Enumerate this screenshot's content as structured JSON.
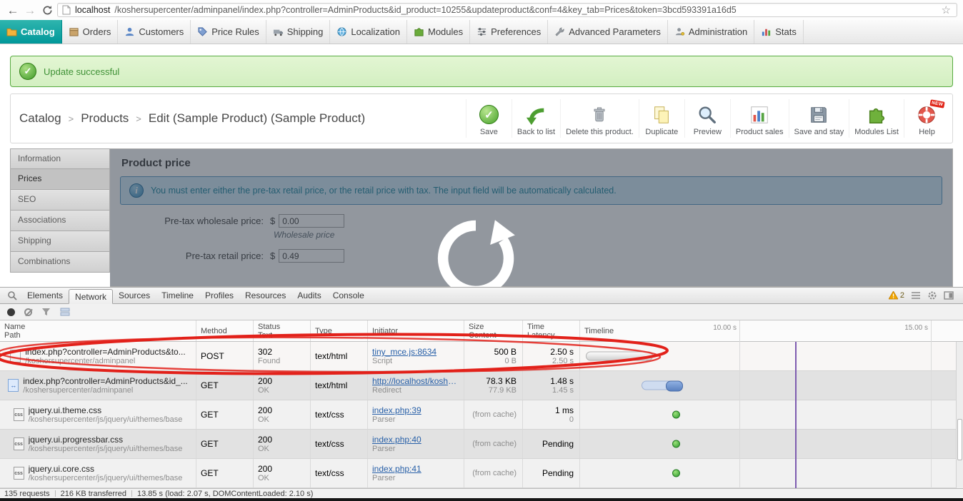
{
  "browser": {
    "url_host": "localhost",
    "url_path": "/koshersupercenter/adminpanel/index.php?controller=AdminProducts&id_product=10255&updateproduct&conf=4&key_tab=Prices&token=3bcd593391a16d5"
  },
  "admin_nav": {
    "tabs": [
      {
        "label": "Catalog"
      },
      {
        "label": "Orders"
      },
      {
        "label": "Customers"
      },
      {
        "label": "Price Rules"
      },
      {
        "label": "Shipping"
      },
      {
        "label": "Localization"
      },
      {
        "label": "Modules"
      },
      {
        "label": "Preferences"
      },
      {
        "label": "Advanced Parameters"
      },
      {
        "label": "Administration"
      },
      {
        "label": "Stats"
      }
    ]
  },
  "alert": {
    "message": "Update successful"
  },
  "breadcrumb": {
    "separator": ">",
    "parts": [
      "Catalog",
      "Products",
      "Edit (Sample Product) (Sample Product)"
    ]
  },
  "toolbar": {
    "buttons": [
      "Save",
      "Back to list",
      "Delete this product.",
      "Duplicate",
      "Preview",
      "Product sales",
      "Save and stay",
      "Modules List",
      "Help"
    ],
    "new_badge": "NEW"
  },
  "product_tabs": [
    {
      "label": "Information"
    },
    {
      "label": "Prices"
    },
    {
      "label": "SEO"
    },
    {
      "label": "Associations"
    },
    {
      "label": "Shipping"
    },
    {
      "label": "Combinations"
    }
  ],
  "panel": {
    "title": "Product price",
    "info": "You must enter either the pre-tax retail price, or the retail price with tax. The input field will be automatically calculated.",
    "fields": [
      {
        "label": "Pre-tax wholesale price:",
        "currency": "$",
        "value": "0.00",
        "hint": "Wholesale price"
      },
      {
        "label": "Pre-tax retail price:",
        "currency": "$",
        "value": "0.49"
      }
    ]
  },
  "devtools": {
    "tabs": [
      {
        "label": "Elements"
      },
      {
        "label": "Network"
      },
      {
        "label": "Sources"
      },
      {
        "label": "Timeline"
      },
      {
        "label": "Profiles"
      },
      {
        "label": "Resources"
      },
      {
        "label": "Audits"
      },
      {
        "label": "Console"
      }
    ],
    "active_tab": "Network",
    "warning_count": "2",
    "columns": [
      {
        "line1": "Name",
        "line2": "Path"
      },
      {
        "line1": "Method",
        "line2": ""
      },
      {
        "line1": "Status",
        "line2": "Text"
      },
      {
        "line1": "Type",
        "line2": ""
      },
      {
        "line1": "Initiator",
        "line2": ""
      },
      {
        "line1": "Size",
        "line2": "Content"
      },
      {
        "line1": "Time",
        "line2": "Latency"
      },
      {
        "line1": "Timeline",
        "line2": ""
      }
    ],
    "timeline_ticks": [
      "10.00 s",
      "15.00 s"
    ],
    "requests": [
      {
        "name": "index.php?controller=AdminProducts&to...",
        "path": "/koshersupercenter/adminpanel",
        "method": "POST",
        "status": "302",
        "status_text": "Found",
        "type": "text/html",
        "initiator": "tiny_mce.js:8634",
        "initiator_detail": "Script",
        "size": "500 B",
        "content": "0 B",
        "time": "2.50 s",
        "latency": "2.50 s"
      },
      {
        "name": "index.php?controller=AdminProducts&id_...",
        "path": "/koshersupercenter/adminpanel",
        "method": "GET",
        "status": "200",
        "status_text": "OK",
        "type": "text/html",
        "initiator": "http://localhost/koshe...",
        "initiator_detail": "Redirect",
        "size": "78.3 KB",
        "content": "77.9 KB",
        "time": "1.48 s",
        "latency": "1.45 s"
      },
      {
        "name": "jquery.ui.theme.css",
        "path": "/koshersupercenter/js/jquery/ui/themes/base",
        "method": "GET",
        "status": "200",
        "status_text": "OK",
        "type": "text/css",
        "initiator": "index.php:39",
        "initiator_detail": "Parser",
        "size": "(from cache)",
        "content": "",
        "time": "1 ms",
        "latency": "0"
      },
      {
        "name": "jquery.ui.progressbar.css",
        "path": "/koshersupercenter/js/jquery/ui/themes/base",
        "method": "GET",
        "status": "200",
        "status_text": "OK",
        "type": "text/css",
        "initiator": "index.php:40",
        "initiator_detail": "Parser",
        "size": "(from cache)",
        "content": "",
        "time": "Pending",
        "latency": ""
      },
      {
        "name": "jquery.ui.core.css",
        "path": "/koshersupercenter/js/jquery/ui/themes/base",
        "method": "GET",
        "status": "200",
        "status_text": "OK",
        "type": "text/css",
        "initiator": "index.php:41",
        "initiator_detail": "Parser",
        "size": "(from cache)",
        "content": "",
        "time": "Pending",
        "latency": ""
      }
    ],
    "status_segments": [
      "135 requests",
      "216 KB transferred",
      "13.85 s (load: 2.07 s, DOMContentLoaded: 2.10 s)"
    ]
  },
  "icons": {
    "check": "✓",
    "info": "i",
    "star": "☆",
    "back_arrow": "←",
    "forward_arrow": "→",
    "redirect_arrows": "↔"
  },
  "colors": {
    "admin_active_tab": "#00989a",
    "success_green": "#3f9136",
    "alert_bg": "#dcf3cb",
    "info_box_bg": "#cfe9f9",
    "link_blue": "#2860a8",
    "timeline_load_line": "#7e5cb0",
    "annotation_red": "#e2211a"
  }
}
